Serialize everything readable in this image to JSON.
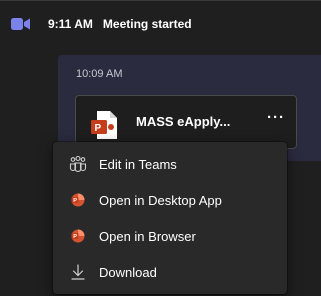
{
  "meeting": {
    "time": "9:11 AM",
    "status": "Meeting started",
    "icon": "video-camera-icon"
  },
  "message": {
    "time": "10:09 AM",
    "file": {
      "name": "MASS eApply...",
      "icon": "powerpoint-icon",
      "more_label": "···"
    }
  },
  "menu": {
    "items": [
      {
        "label": "Edit in Teams",
        "icon": "teams-icon"
      },
      {
        "label": "Open in Desktop App",
        "icon": "powerpoint-icon"
      },
      {
        "label": "Open in Browser",
        "icon": "powerpoint-icon"
      },
      {
        "label": "Download",
        "icon": "download-icon"
      }
    ]
  },
  "colors": {
    "background": "#1f1f1f",
    "bubble": "#2b2b40",
    "menu": "#292929",
    "accent": "#6264a7",
    "powerpoint": "#c43e1c"
  }
}
